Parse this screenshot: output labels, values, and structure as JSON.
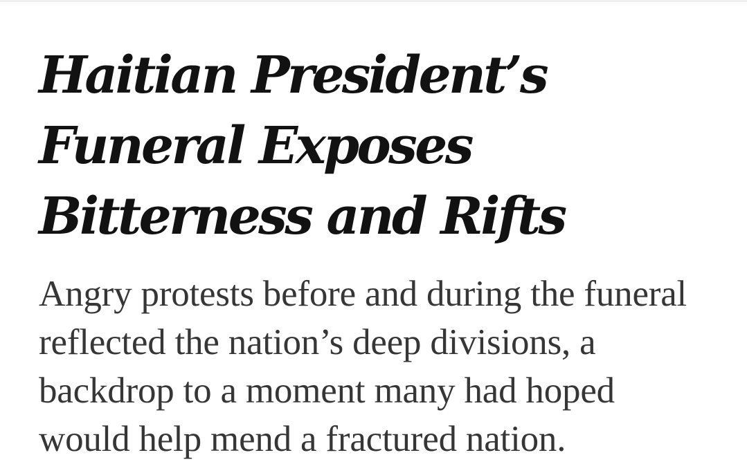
{
  "article": {
    "headline": "Haitian President’s Funeral Exposes Bitterness and Rifts",
    "summary": "Angry protests before and during the funeral reflected the nation’s deep divisions, a backdrop to a moment many had hoped would help mend a fractured nation."
  }
}
